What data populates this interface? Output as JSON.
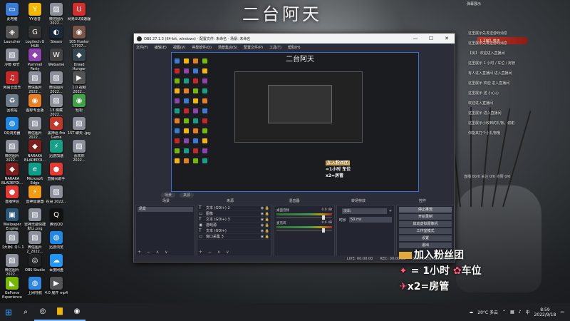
{
  "wallpaper": {
    "title": "二台阿天"
  },
  "desktop_icons": [
    {
      "label": "此电脑",
      "icon": "computer-icon",
      "color": "#3a7bd5",
      "glyph": "▭"
    },
    {
      "label": "Launcher",
      "icon": "launcher-icon",
      "color": "#555",
      "glyph": "◈"
    },
    {
      "label": "冷暖 细节",
      "icon": "image-file-icon",
      "color": "#8a8f99",
      "glyph": "▨"
    },
    {
      "label": "网易云音乐",
      "icon": "music-icon",
      "color": "#c62828",
      "glyph": "♫"
    },
    {
      "label": "回收站",
      "icon": "recycle-bin-icon",
      "color": "#6c7a89",
      "glyph": "♻"
    },
    {
      "label": "QQ浏览器",
      "icon": "browser-icon",
      "color": "#1e88e5",
      "glyph": "◍"
    },
    {
      "label": "微信图片 2022...",
      "icon": "image-file-icon",
      "color": "#8a8f99",
      "glyph": "▨"
    },
    {
      "label": "NARAKA BLADEPOI...",
      "icon": "game-icon",
      "color": "#7b1f1f",
      "glyph": "◆"
    },
    {
      "label": "直播伴侣",
      "icon": "live-icon",
      "color": "#e53935",
      "glyph": "●"
    },
    {
      "label": "Wallpaper Engine",
      "icon": "wallpaper-icon",
      "color": "#2b5876",
      "glyph": "▣"
    },
    {
      "label": "【大师】Q L 1",
      "icon": "image-file-icon",
      "color": "#8a8f99",
      "glyph": "▨"
    },
    {
      "label": "微信图片 2022...",
      "icon": "image-file-icon",
      "color": "#8a8f99",
      "glyph": "▨"
    },
    {
      "label": "GeForce Experience",
      "icon": "nvidia-icon",
      "color": "#76b900",
      "glyph": "◣"
    },
    {
      "label": "YY语音",
      "icon": "yy-icon",
      "color": "#f2b705",
      "glyph": "Y"
    },
    {
      "label": "Logitech G HUB",
      "icon": "logitech-icon",
      "color": "#333",
      "glyph": "G"
    },
    {
      "label": "Pummel Party",
      "icon": "game-icon",
      "color": "#8e44ad",
      "glyph": "◆"
    },
    {
      "label": "微信图片 2022...",
      "icon": "image-file-icon",
      "color": "#8a8f99",
      "glyph": "▨"
    },
    {
      "label": "图标专业版",
      "icon": "app-icon",
      "color": "#e67e22",
      "glyph": "◉"
    },
    {
      "label": "微信图片 2022...",
      "icon": "image-file-icon",
      "color": "#8a8f99",
      "glyph": "▨"
    },
    {
      "label": "NARAKA BLADEPOI...",
      "icon": "game-icon",
      "color": "#7b1f1f",
      "glyph": "◆"
    },
    {
      "label": "Microsoft Edge",
      "icon": "edge-icon",
      "color": "#0f9d8a",
      "glyph": "e"
    },
    {
      "label": "雷神加速器",
      "icon": "accelerator-icon",
      "color": "#f39c12",
      "glyph": "⚡"
    },
    {
      "label": "雷神无疆快捷 默认.png",
      "icon": "image-file-icon",
      "color": "#8a8f99",
      "glyph": "▨"
    },
    {
      "label": "微信图片 2_2022...",
      "icon": "image-file-icon",
      "color": "#8a8f99",
      "glyph": "▨"
    },
    {
      "label": "OBS Studio",
      "icon": "obs-icon",
      "color": "#222",
      "glyph": "◎"
    },
    {
      "label": "上网导航",
      "icon": "browser-icon",
      "color": "#2e86de",
      "glyph": "◍"
    },
    {
      "label": "微信图片 2022...",
      "icon": "image-file-icon",
      "color": "#8a8f99",
      "glyph": "▨"
    },
    {
      "label": "Steam",
      "icon": "steam-icon",
      "color": "#1b2838",
      "glyph": "◐"
    },
    {
      "label": "WeGame",
      "icon": "wegame-icon",
      "color": "#444",
      "glyph": "W"
    },
    {
      "label": "微信图片 2022...",
      "icon": "image-file-icon",
      "color": "#8a8f99",
      "glyph": "▨"
    },
    {
      "label": "13 棋藏 2022...",
      "icon": "image-file-icon",
      "color": "#8a8f99",
      "glyph": "▨"
    },
    {
      "label": "黑神话 Pro Game",
      "icon": "game-icon",
      "color": "#c0392b",
      "glyph": "◆"
    },
    {
      "label": "迅游加速",
      "icon": "accelerator-icon",
      "color": "#16a085",
      "glyph": "⚡"
    },
    {
      "label": "直播间助手",
      "icon": "live-icon",
      "color": "#e53935",
      "glyph": "●"
    },
    {
      "label": "在哥 2022...",
      "icon": "image-file-icon",
      "color": "#8a8f99",
      "glyph": "▨"
    },
    {
      "label": "腾讯QQ",
      "icon": "qq-icon",
      "color": "#111",
      "glyph": "Q"
    },
    {
      "label": "迅游浏览",
      "icon": "browser-icon",
      "color": "#1e88e5",
      "glyph": "◍"
    },
    {
      "label": "百度网盘",
      "icon": "cloud-icon",
      "color": "#2196f3",
      "glyph": "☁"
    },
    {
      "label": "4.0 展开 mp4",
      "icon": "video-file-icon",
      "color": "#555",
      "glyph": "▶"
    },
    {
      "label": "网易UU加速器",
      "icon": "accelerator-icon",
      "color": "#d32f2f",
      "glyph": "U"
    },
    {
      "label": "105 Hunter 17707...",
      "icon": "app-icon",
      "color": "#795548",
      "glyph": "◉"
    },
    {
      "label": "Dread Hunger",
      "icon": "game-icon",
      "color": "#37474f",
      "glyph": "◆"
    },
    {
      "label": "1.0 视频 2022...",
      "icon": "video-file-icon",
      "color": "#555",
      "glyph": "▶"
    },
    {
      "label": "轻松",
      "icon": "app-icon",
      "color": "#43a047",
      "glyph": "◉"
    },
    {
      "label": "15T 聊天 .jpg",
      "icon": "image-file-icon",
      "color": "#8a8f99",
      "glyph": "▨"
    },
    {
      "label": "喜欢你 2022...",
      "icon": "image-file-icon",
      "color": "#8a8f99",
      "glyph": "▨"
    }
  ],
  "chat": {
    "top_label": "弹幕展示",
    "vip_label": "L【房】荒天",
    "messages": [
      "这里展示先发送游戏消息",
      "这里展示先发送游戏消息",
      "【房】 欢迎进入直播间",
      "这里展示 1 小时 / 车位 / 房管",
      "有人进入直播间 进入直播间",
      "这里展示 欢迎 进入直播间",
      "这里展示 送 小心心",
      "欢迎进入直播间",
      "这里展示 进入直播间",
      "这里展示小收到的礼物，谢谢",
      "你能来打个小礼物哦"
    ],
    "stats": "直播 00/0 关注 0/0 点赞 0/0"
  },
  "obs": {
    "title": "OBS 27.1.3 (64-bit, windows) - 配置文件: 未命名 - 场景: 未命名",
    "menu": [
      "文件(F)",
      "编辑(E)",
      "视图(V)",
      "停靠部件(D)",
      "场景集合(S)",
      "配置文件(P)",
      "工具(T)",
      "帮助(H)"
    ],
    "preview_title": "二台阿天",
    "preview_promo": [
      "加入粉丝团",
      "=1小时 车位",
      "x2=房管"
    ],
    "scene_tabs": {
      "scene": "场景",
      "source": "来源"
    },
    "dock_titles": [
      "场景",
      "来源",
      "混音器",
      "转场特效",
      "控件"
    ],
    "scenes": [
      "场景"
    ],
    "sources": [
      {
        "icon": "T",
        "name": "文本 (GDI+) 2"
      },
      {
        "icon": "▭",
        "name": "图像"
      },
      {
        "icon": "T",
        "name": "文本 (GDI+) 3"
      },
      {
        "icon": "◉",
        "name": "游戏源"
      },
      {
        "icon": "T",
        "name": "文本 (GDI+)"
      },
      {
        "icon": "▭",
        "name": "窗口采集 3"
      }
    ],
    "mixer": [
      {
        "name": "桌面音频",
        "db": "0.0 dB"
      },
      {
        "name": "麦克风",
        "db": "0.0 dB"
      }
    ],
    "transition": {
      "type": "淡出",
      "duration_label": "时长",
      "duration": "50 ms"
    },
    "controls": [
      "停止推流",
      "开始录制",
      "启动虚拟摄像机",
      "工作室模式",
      "设置",
      "退出"
    ],
    "dock_footer": "+ − ∧ ∨",
    "status": {
      "live": "LIVE: 00:00:00",
      "rec": "REC: 00:00:00",
      "cpu": "CPU: 3.0%, 60.00 fps"
    }
  },
  "overlay_promo": {
    "line1": "加入粉丝团",
    "line2_prefix": "= 1小时",
    "line2_suffix": "车位",
    "line3": "x2=房管"
  },
  "taskbar": {
    "weather": "20°C 多云",
    "time": "8:59",
    "date": "2022/9/18"
  }
}
